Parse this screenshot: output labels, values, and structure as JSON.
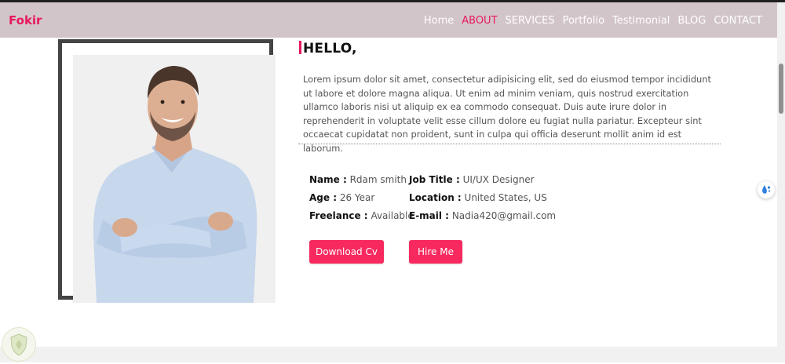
{
  "brand": "Fokir",
  "nav": {
    "items": [
      "Home",
      "ABOUT",
      "SERVICES",
      "Portfolio",
      "Testimonial",
      "BLOG",
      "CONTACT"
    ],
    "active": "ABOUT"
  },
  "about": {
    "greeting": "HELLO,",
    "paragraph": "Lorem ipsum dolor sit amet, consectetur adipisicing elit, sed do eiusmod tempor incididunt ut labore et dolore magna aliqua. Ut enim ad minim veniam, quis nostrud exercitation ullamco laboris nisi ut aliquip ex ea commodo consequat. Duis aute irure dolor in reprehenderit in voluptate velit esse cillum dolore eu fugiat nulla pariatur. Excepteur sint occaecat cupidatat non proident, sunt in culpa qui officia deserunt mollit anim id est laborum.",
    "info_left": [
      {
        "label": "Name :",
        "value": "Rdam smith"
      },
      {
        "label": "Age :",
        "value": "26 Year"
      },
      {
        "label": "Freelance :",
        "value": "Available"
      }
    ],
    "info_right": [
      {
        "label": "Job Title :",
        "value": "UI/UX Designer"
      },
      {
        "label": "Location :",
        "value": "United States, US"
      },
      {
        "label": "E-mail :",
        "value": "Nadia420@gmail.com"
      }
    ],
    "buttons": {
      "download_label": "Download Cv",
      "hire_label": "Hire Me"
    }
  },
  "colors": {
    "accent": "#e8185e",
    "button": "#f7295f",
    "navbar": "#d2c5c9"
  },
  "icons": {
    "photo": "person-portrait",
    "floating_widget": "water-drop-icon",
    "corner_badge": "shield-logo-icon"
  }
}
